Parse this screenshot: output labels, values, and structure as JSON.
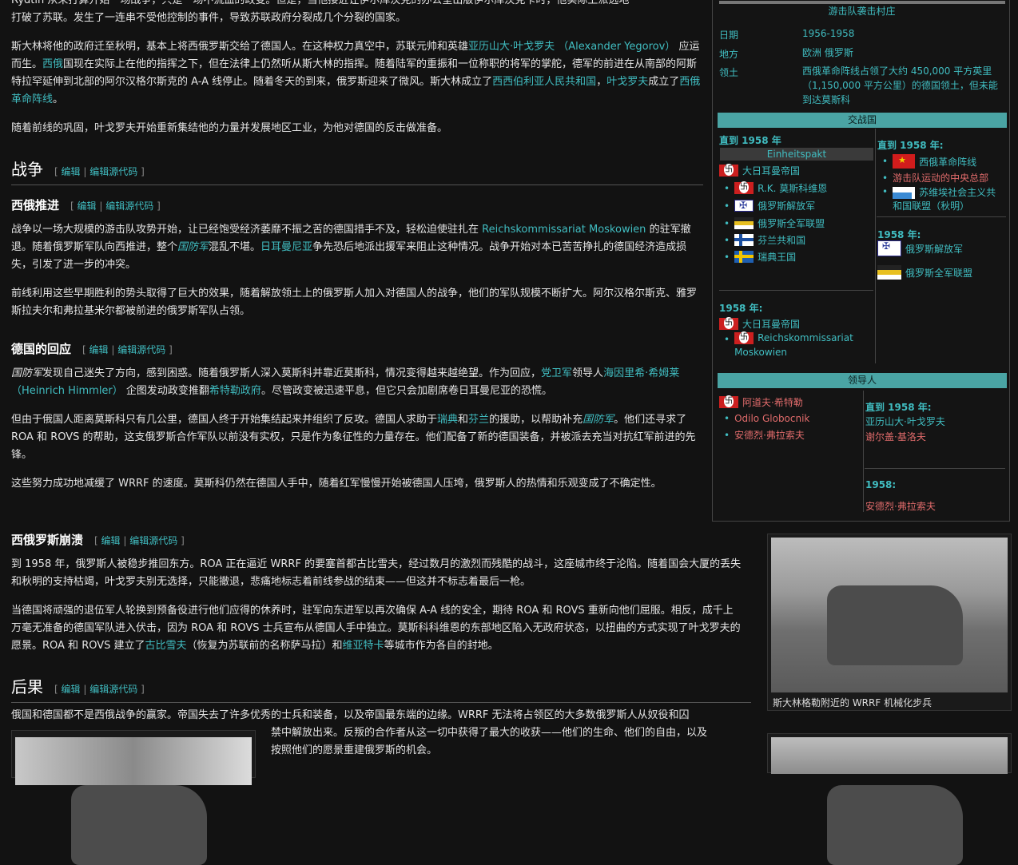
{
  "article": {
    "p0_l1": "Rydtin 从未打算开始一场战争，只是一场不流血的政变。但是，当他接近让伊尔库茨克的办公室出版伊尔库茨克卡时，他实际上派远地",
    "p0_l2": "打破了苏联。发生了一连串不受他控制的事件，导致苏联政府分裂成几个分裂的国家。",
    "p1": {
      "t1": "斯大林将他的政府迁至秋明，基本上将西俄罗斯交给了德国人。在这种权力真空中，苏联元帅和英雄",
      "l1": "亚历山大·叶戈罗夫 （Alexander Yegorov）",
      "t2": " 应运而生。",
      "l2": "西俄",
      "t3": "国现在实际上在他的指挥之下，但在法律上仍然听从斯大林的指挥。随着陆军的重振和一位称职的将军的掌舵，德军的前进在从南部的阿斯特拉罕延伸到北部的阿尔汉格尔斯克的 A-A 线停止。随着冬天的到来，俄罗斯迎来了微风。斯大林成立了",
      "l3": "西西伯利亚人民共和国",
      "t4": "，",
      "l4": "叶戈罗夫",
      "t5": "成立了",
      "l5": "西俄革命阵线",
      "t6": "。"
    },
    "p2": "随着前线的巩固，叶戈罗夫开始重新集结他的力量并发展地区工业，为他对德国的反击做准备。",
    "edit": {
      "open": "[",
      "edit": "编辑",
      "pipe": "|",
      "source": "编辑源代码",
      "close": "]"
    },
    "h_war": "战争",
    "h_push": "西俄推进",
    "p3": {
      "t1": "战争以一场大规模的游击队攻势开始，让已经饱受经济萎靡不振之苦的德国措手不及，轻松迫使驻扎在 ",
      "l1": "Reichskommissariat Moskowien",
      "t2": " 的驻军撤退。随着俄罗斯军队向西推进，整个",
      "l2": "国防军",
      "t3": "混乱不堪。",
      "l3": "日耳曼尼亚",
      "t4": "争先恐后地派出援军来阻止这种情况。战争开始对本已苦苦挣扎的德国经济造成损失，引发了进一步的冲突。"
    },
    "p4": "前线利用这些早期胜利的势头取得了巨大的效果，随着解放领土上的俄罗斯人加入对德国人的战争，他们的军队规模不断扩大。阿尔汉格尔斯克、雅罗斯拉夫尔和弗拉基米尔都被前进的俄罗斯军队占领。",
    "h_response": "德国的回应",
    "p5": {
      "l1": "国防军",
      "t1": "发现自己迷失了方向，感到困惑。随着俄罗斯人深入莫斯科并靠近莫斯科，情况变得越来越绝望。作为回应，",
      "l2": "党卫军",
      "t2": "领导人",
      "l3": "海因里希·希姆莱 （Heinrich Himmler）",
      "t3": " 企图发动政变推翻",
      "l4": "希特勒政府",
      "t4": "。尽管政变被迅速平息，但它只会加剧席卷日耳曼尼亚的恐慌。"
    },
    "p6": {
      "t1": "但由于俄国人距离莫斯科只有几公里，德国人终于开始集结起来并组织了反攻。德国人求助于",
      "l1": "瑞典",
      "t2": "和",
      "l2": "芬兰",
      "t3": "的援助，以帮助补充",
      "l3": "国防军",
      "t4": "。他们还寻求了 ROA 和 ROVS 的帮助，这支俄罗斯合作军队以前没有实权，只是作为象征性的力量存在。他们配备了新的德国装备，并被派去充当对抗红军前进的先锋。"
    },
    "p7": "这些努力成功地减缓了 WRRF 的速度。莫斯科仍然在德国人手中，随着红军慢慢开始被德国人压垮，俄罗斯人的热情和乐观变成了不确定性。",
    "h_collapse": "西俄罗斯崩溃",
    "p8": "到 1958 年，俄罗斯人被稳步推回东方。ROA 正在逼近 WRRF 的要塞首都古比雪夫，经过数月的激烈而残酷的战斗，这座城市终于沦陷。随着国会大厦的丢失和秋明的支持枯竭，叶戈罗夫别无选择，只能撤退，悲痛地标志着前线参战的结束——但这并不标志着最后一枪。",
    "p9": {
      "t1": "当德国将顽强的退伍军人轮换到预备役进行他们应得的休养时，驻军向东进军以再次确保 A-A 线的安全，期待 ROA 和 ROVS 重新向他们屈服。相反，成千上万毫无准备的德国军队进入伏击，因为 ROA 和 ROVS 士兵宣布从德国人手中独立。莫斯科科维恩的东部地区陷入无政府状态，以扭曲的方式实现了叶戈罗夫的愿景。ROA 和 ROVS 建立了",
      "l1": "古比雪夫",
      "t2": "（恢复为苏联前的名称萨马拉）和",
      "l2": "维亚特卡",
      "t3": "等城市作为各自的封地。"
    },
    "h_after": "后果",
    "p10_l1": "俄国和德国都不是西俄战争的赢家。帝国失去了许多优秀的士兵和装备，以及帝国最东端的边缘。WRRF 无法将占领区的大多数俄罗斯人从奴役和囚",
    "p10_l2": "禁中解放出来。反叛的合作者从这一切中获得了最大的收获——他们的生命、他们的自由，以及",
    "p10_l3": "按照他们的愿景重建俄罗斯的机会。"
  },
  "infobox": {
    "img_caption": "游击队袭击村庄",
    "date_label": "日期",
    "date_val": "1956-1958",
    "place_label": "地方",
    "place_val": "欧洲 俄罗斯",
    "terr_label": "领土",
    "terr_val": "西俄革命阵线占领了大约 450,000 平方英里（1,150,000 平方公里）的德国领土，但未能到达莫斯科",
    "belligerents": "交战国",
    "left_until": "直到 1958 年",
    "einheitspakt": "Einheitspakt",
    "reich": "大日耳曼帝国",
    "rk": "R.K. 莫斯科维恩",
    "roa": "俄罗斯解放军",
    "rovs": "俄罗斯全军联盟",
    "finland": "芬兰共和国",
    "sweden": "瑞典王国",
    "left_1958": "1958 年:",
    "reich2": "大日耳曼帝国",
    "rk_full": "Reichskommissariat Moskowien",
    "right_until": "直到 1958 年:",
    "wrrf": "西俄革命阵线",
    "partisan": "游击队运动的中央总部",
    "soviet": "苏维埃社会主义共和国联盟（秋明）",
    "right_1958": "1958 年:",
    "roa2": "俄罗斯解放军",
    "rovs2": "俄罗斯全军联盟",
    "leaders": "领导人",
    "hitler": "阿道夫·希特勒",
    "globocnik": "Odilo Globocnik",
    "vlasov": "安德烈·弗拉索夫",
    "r_until": "直到 1958 年:",
    "yegorov": "亚历山大·叶戈罗夫",
    "sergei": "谢尔盖·基洛夫",
    "r_1958": "1958:",
    "vlasov2": "安德烈·弗拉索夫"
  },
  "thumb_caption": "斯大林格勒附近的 WRRF 机械化步兵"
}
